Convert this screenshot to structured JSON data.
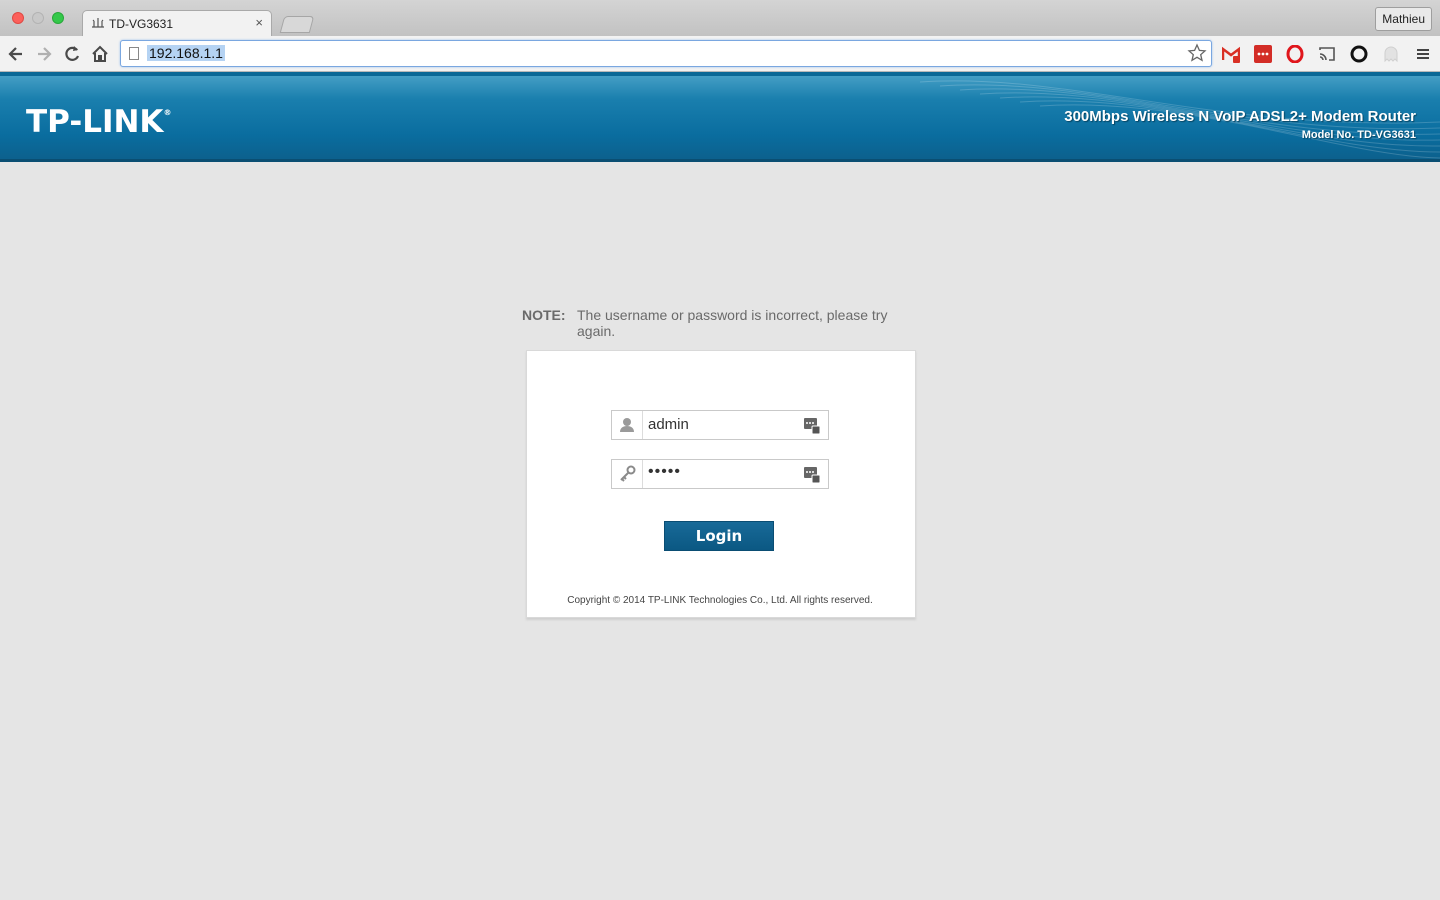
{
  "browser": {
    "tab_title": "TD-VG3631",
    "tab_close": "×",
    "user_name": "Mathieu",
    "url": "192.168.1.1",
    "icons": [
      "back-icon",
      "forward-icon",
      "reload-icon",
      "home-icon",
      "star-icon",
      "gmail-icon",
      "lastpass-icon",
      "opera-icon",
      "cast-icon",
      "circle-icon",
      "ghost-icon",
      "menu-icon"
    ]
  },
  "header": {
    "logo": "TP-LINK",
    "logo_mark": "®",
    "product_name": "300Mbps Wireless N VoIP ADSL2+ Modem Router",
    "model_no": "Model No. TD-VG3631",
    "colors": {
      "banner": "#0a6d9f",
      "button": "#0f6390"
    }
  },
  "login": {
    "note_label": "NOTE:",
    "note_text": "The username or password is incorrect, please try again.",
    "username": "admin",
    "password_mask": "•••••",
    "button_label": "Login",
    "copyright": "Copyright © 2014 TP-LINK Technologies Co., Ltd. All rights reserved."
  }
}
